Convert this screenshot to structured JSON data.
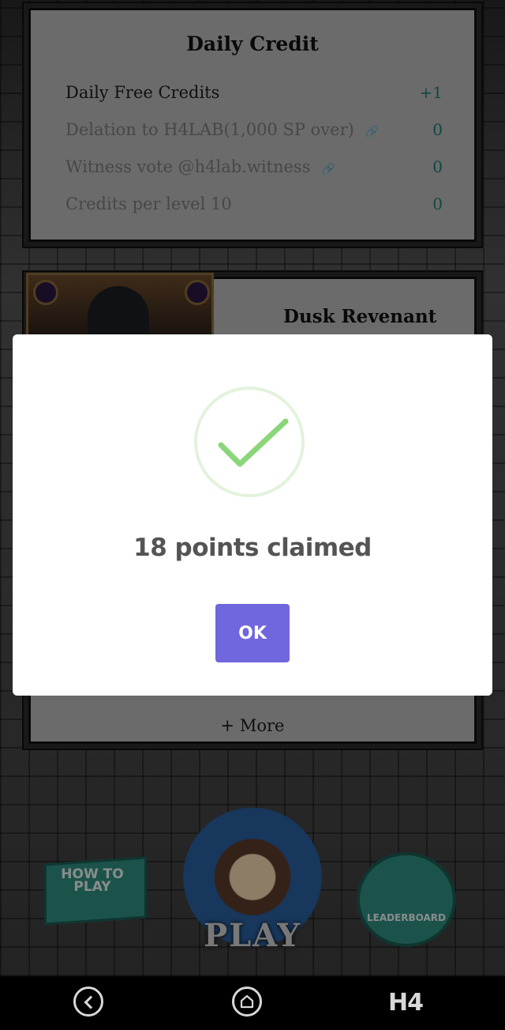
{
  "daily_credit": {
    "title": "Daily Credit",
    "rows": [
      {
        "label": "Daily Free Credits",
        "value": "+1",
        "link": false
      },
      {
        "label": "Delation to H4LAB(1,000 SP over)",
        "value": "0",
        "link": true
      },
      {
        "label": "Witness vote @h4lab.witness",
        "value": "0",
        "link": true
      },
      {
        "label": "Credits per level 10",
        "value": "0",
        "link": false
      }
    ]
  },
  "monster_card": {
    "name": "Dusk Revenant",
    "more_label": "+ More"
  },
  "game_menu": {
    "how_to_play": "HOW TO PLAY",
    "play": "PLAY",
    "leaderboard": "LEADERBOARD"
  },
  "modal": {
    "message": "18 points claimed",
    "ok_label": "OK",
    "icon": "check-icon",
    "accent_color": "#7066de",
    "check_color": "#8bd67a"
  },
  "navbar": {
    "app_label": "H4"
  }
}
